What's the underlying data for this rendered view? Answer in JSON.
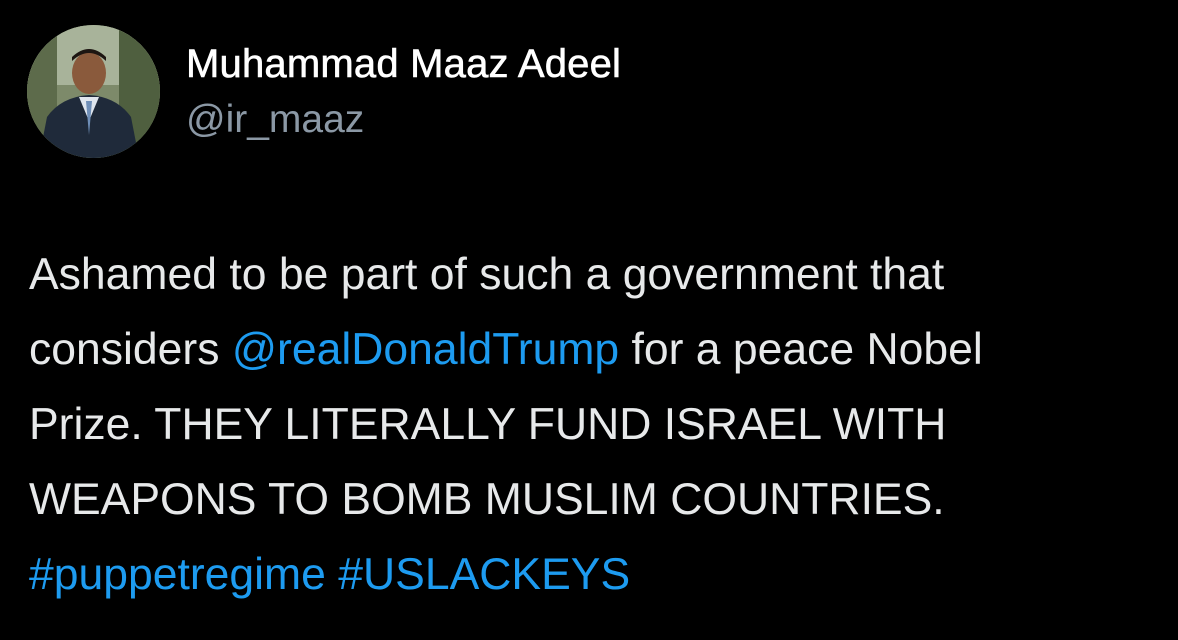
{
  "author": {
    "display_name": "Muhammad Maaz Adeel",
    "handle": "@ir_maaz",
    "avatar_icon": "profile-photo"
  },
  "tweet": {
    "line1": "Ashamed to be part of such a government that",
    "line2_pre": "considers ",
    "mention": "@realDonaldTrump",
    "line2_post": " for a peace Nobel",
    "line3": "Prize. THEY LITERALLY FUND ISRAEL WITH",
    "line4": "WEAPONS TO BOMB MUSLIM COUNTRIES.",
    "hashtag1": "#puppetregime",
    "hashtag_sep": " ",
    "hashtag2": "#USLACKEYS"
  },
  "colors": {
    "background": "#000000",
    "text": "#e7e9ea",
    "secondary": "#8b98a5",
    "link": "#1d9bf0"
  }
}
